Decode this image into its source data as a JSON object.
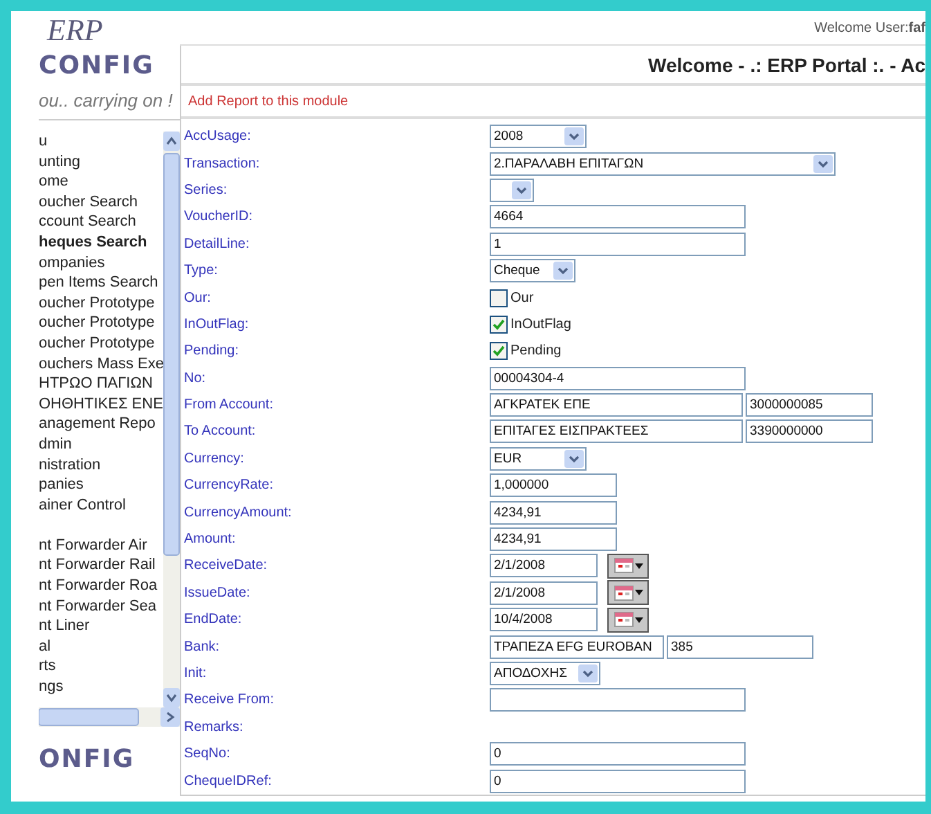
{
  "sidebar": {
    "logo_top": "ERP",
    "logo_name": "CONFIG",
    "tagline": "ou.. carrying on !",
    "items": [
      {
        "label": "u",
        "selected": false
      },
      {
        "label": "unting",
        "selected": false
      },
      {
        "label": "ome",
        "selected": false
      },
      {
        "label": "oucher Search",
        "selected": false
      },
      {
        "label": "ccount Search",
        "selected": false
      },
      {
        "label": "heques Search",
        "selected": true
      },
      {
        "label": "ompanies",
        "selected": false
      },
      {
        "label": "pen Items Search",
        "selected": false
      },
      {
        "label": "oucher Prototype",
        "selected": false
      },
      {
        "label": "oucher Prototype",
        "selected": false
      },
      {
        "label": "oucher Prototype",
        "selected": false
      },
      {
        "label": "ouchers Mass Exe",
        "selected": false
      },
      {
        "label": "ΗΤΡΩΟ ΠΑΓΙΩΝ",
        "selected": false
      },
      {
        "label": "ΟΗΘΗΤΙΚΕΣ ΕΝΕ",
        "selected": false
      },
      {
        "label": "anagement Repo",
        "selected": false
      },
      {
        "label": "dmin",
        "selected": false
      },
      {
        "label": "nistration",
        "selected": false
      },
      {
        "label": "panies",
        "selected": false
      },
      {
        "label": "ainer Control",
        "selected": false
      },
      {
        "label": "nt Forwarder Air",
        "selected": false
      },
      {
        "label": "nt Forwarder Rail",
        "selected": false
      },
      {
        "label": "nt Forwarder Roa",
        "selected": false
      },
      {
        "label": "nt Forwarder Sea",
        "selected": false
      },
      {
        "label": "nt Liner",
        "selected": false
      },
      {
        "label": "al",
        "selected": false
      },
      {
        "label": "rts",
        "selected": false
      },
      {
        "label": "ngs",
        "selected": false
      }
    ],
    "footer_logo": "ONFIG"
  },
  "header": {
    "user_greeting": "Welcome User:**faf**",
    "title": "Welcome - .: ERP Portal :. - Ac"
  },
  "add_report_link": "Add Report to this module",
  "fields": [
    {
      "label": "AccUsage:",
      "kind": "select",
      "value": "2008"
    },
    {
      "label": "Transaction:",
      "kind": "select",
      "value": "2.ΠΑΡΑΛΑΒΗ ΕΠΙΤΑΓΩΝ"
    },
    {
      "label": "Series:",
      "kind": "select"
    },
    {
      "label": "VoucherID:",
      "kind": "text",
      "value": "4664"
    },
    {
      "label": "DetailLine:",
      "kind": "text",
      "value": "1"
    },
    {
      "label": "Type:",
      "kind": "select",
      "value": "Cheque"
    },
    {
      "label": "Our:",
      "kind": "checkbox",
      "text": "Our",
      "checked": false
    },
    {
      "label": "InOutFlag:",
      "kind": "checkbox",
      "text": "InOutFlag",
      "checked": true
    },
    {
      "label": "Pending:",
      "kind": "checkbox",
      "text": "Pending",
      "checked": true
    },
    {
      "label": "No:",
      "kind": "text",
      "value": "00004304-4"
    },
    {
      "label": "From Account:",
      "kind": "pair",
      "values": [
        "ΑΓΚΡΑΤΕΚ ΕΠΕ",
        "3000000085"
      ]
    },
    {
      "label": "To Account:",
      "kind": "pair",
      "values": [
        "ΕΠΙΤΑΓΕΣ ΕΙΣΠΡΑΚΤΕΕΣ",
        "3390000000"
      ]
    },
    {
      "label": "Currency:",
      "kind": "select",
      "value": "EUR"
    },
    {
      "label": "CurrencyRate:",
      "kind": "text",
      "value": "1,000000"
    },
    {
      "label": "CurrencyAmount:",
      "kind": "text",
      "value": "4234,91"
    },
    {
      "label": "Amount:",
      "kind": "text",
      "value": "4234,91"
    },
    {
      "label": "ReceiveDate:",
      "kind": "date",
      "value": "2/1/2008"
    },
    {
      "label": "IssueDate:",
      "kind": "date",
      "value": "2/1/2008"
    },
    {
      "label": "EndDate:",
      "kind": "date",
      "value": "10/4/2008"
    },
    {
      "label": "Bank:",
      "kind": "pair",
      "values": [
        "ΤΡΑΠΕΖΑ EFG EUROBAN",
        "385"
      ]
    },
    {
      "label": "Init:",
      "kind": "select",
      "value": "ΑΠΟΔΟΧΗΣ"
    },
    {
      "label": "Receive From:",
      "kind": "text"
    },
    {
      "label": "Remarks:",
      "kind": "none"
    },
    {
      "label": "SeqNo:",
      "kind": "text",
      "value": "0"
    },
    {
      "label": "ChequeIDRef:",
      "kind": "text",
      "value": "0"
    }
  ]
}
